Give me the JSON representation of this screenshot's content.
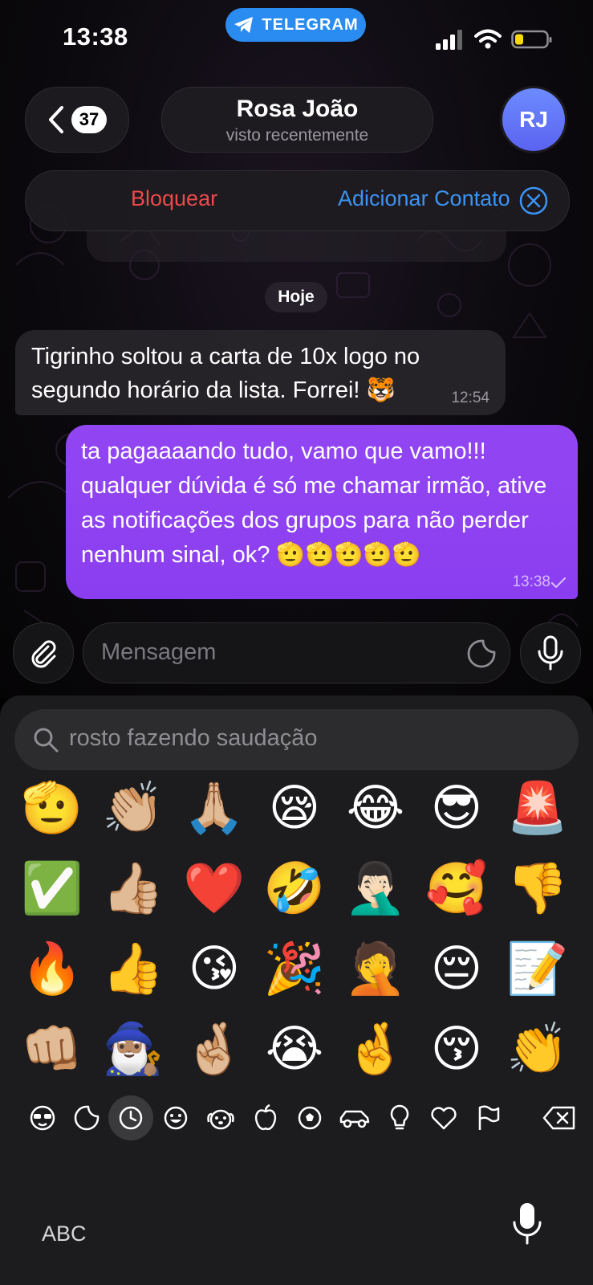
{
  "status_bar": {
    "time": "13:38",
    "app_pill": "TELEGRAM"
  },
  "header": {
    "back_count": "37",
    "contact_name": "Rosa João",
    "contact_status": "visto recentemente",
    "avatar_initials": "RJ"
  },
  "action_bar": {
    "block_label": "Bloquear",
    "add_contact_label": "Adicionar Contato"
  },
  "chat": {
    "date_chip": "Hoje",
    "messages": [
      {
        "direction": "incoming",
        "text": "Tigrinho soltou a carta de 10x logo no segundo horário da lista. Forrei! 🐯",
        "time": "12:54"
      },
      {
        "direction": "outgoing",
        "text": "ta pagaaaando tudo, vamo que vamo!!! qualquer dúvida é só me chamar irmão, ative as notificações dos grupos para não perder nenhum sinal, ok? 🫡🫡🫡🫡🫡",
        "time": "13:38",
        "status": "sent-check"
      }
    ]
  },
  "composer": {
    "placeholder": "Mensagem"
  },
  "emoji_panel": {
    "search_query": "rosto fazendo saudação",
    "rows": [
      [
        "🫡",
        "👏🏼",
        "🙏🏼",
        "😪",
        "😂",
        "😎",
        "🚨"
      ],
      [
        "✅",
        "👍🏼",
        "❤️",
        "🤣",
        "🤦🏻‍♂️",
        "🥰",
        "👎"
      ],
      [
        "🔥",
        "👍",
        "😘",
        "🎉",
        "🤦",
        "😔",
        "📝"
      ],
      [
        "👊🏼",
        "🧙🏽‍♂️",
        "🤞🏼",
        "😭",
        "🤞",
        "😚",
        "👏"
      ]
    ],
    "categories": [
      "mask-icon",
      "sticker-icon",
      "recent-clock-icon",
      "smiley-icon",
      "animal-icon",
      "apple-icon",
      "ball-icon",
      "car-icon",
      "bulb-icon",
      "heart-icon",
      "flag-icon",
      "backspace-icon"
    ],
    "selected_category": "recent-clock-icon",
    "abc_label": "ABC"
  },
  "colors": {
    "accent_blue": "#3b94f5",
    "danger_red": "#ea4b4b",
    "outgoing_bubble": "#8a3ef0",
    "telegram_pill": "#2a8cf0",
    "avatar": "#5a63f0"
  }
}
